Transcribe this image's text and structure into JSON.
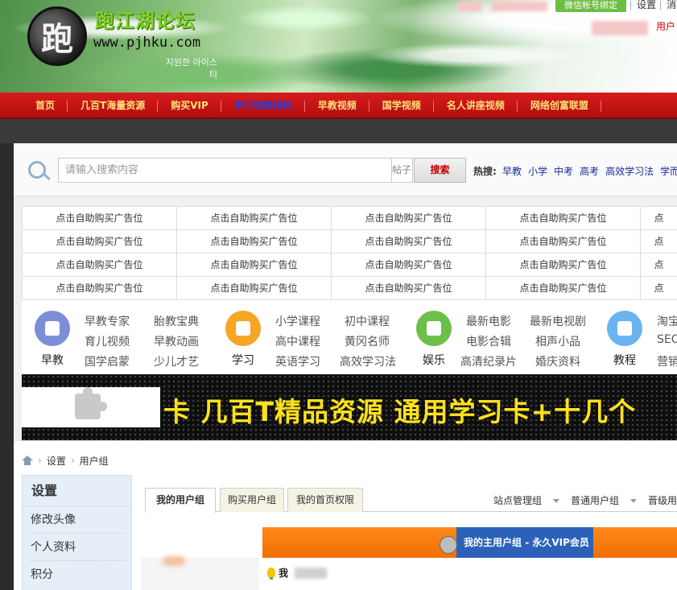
{
  "header": {
    "logo_char": "跑",
    "site_title": "跑江湖论坛",
    "site_url": "www.pjhku.com",
    "logo_sub": "지원한 아이스티",
    "wechat_label": "微信帐号绑定",
    "settings_link": "设置",
    "clear_link": "消",
    "user_link": "用户"
  },
  "nav": {
    "items": [
      {
        "label": "首页"
      },
      {
        "label": "几百T海量资源"
      },
      {
        "label": "购买VIP"
      },
      {
        "label": "学习视频资料"
      },
      {
        "label": "早教视频"
      },
      {
        "label": "国学视频"
      },
      {
        "label": "名人讲座视频"
      },
      {
        "label": "网络创富联盟"
      }
    ]
  },
  "search": {
    "placeholder": "请输入搜索内容",
    "type_label": "帖子",
    "button_label": "搜索",
    "hot_label": "热搜:",
    "hot_links": [
      "早教",
      "小学",
      "中考",
      "高考",
      "高效学习法",
      "学而"
    ]
  },
  "ads": {
    "rows": [
      [
        "点击自助购买广告位",
        "点击自助购买广告位",
        "点击自助购买广告位",
        "点击自助购买广告位",
        "点"
      ],
      [
        "点击自助购买广告位",
        "点击自助购买广告位",
        "点击自助购买广告位",
        "点击自助购买广告位",
        "点"
      ],
      [
        "点击自助购买广告位",
        "点击自助购买广告位",
        "点击自助购买广告位",
        "点击自助购买广告位",
        "点"
      ],
      [
        "点击自助购买广告位",
        "点击自助购买广告位",
        "点击自助购买广告位",
        "点击自助购买广告位",
        "点"
      ]
    ]
  },
  "categories": [
    {
      "title": "早教",
      "color": "#7c8fd6",
      "links": [
        "早教专家",
        "胎教宝典",
        "育儿视频",
        "早教动画",
        "国学启蒙",
        "少儿才艺"
      ]
    },
    {
      "title": "学习",
      "color": "#f5a623",
      "links": [
        "小学课程",
        "初中课程",
        "高中课程",
        "黄冈名师",
        "英语学习",
        "高效学习法"
      ]
    },
    {
      "title": "娱乐",
      "color": "#6cc04a",
      "links": [
        "最新电影",
        "最新电视剧",
        "电影合辑",
        "相声小品",
        "高清纪录片",
        "婚庆资料"
      ]
    },
    {
      "title": "教程",
      "color": "#6ab4f0",
      "links": [
        "淘宝",
        "SEO",
        "营销"
      ]
    }
  ],
  "banner": {
    "text": "卡 几百T精品资源 通用学习卡+十几个"
  },
  "breadcrumb": {
    "items": [
      "设置",
      "用户组"
    ]
  },
  "sidebar": {
    "title": "设置",
    "items": [
      "修改头像",
      "个人资料",
      "积分"
    ]
  },
  "tabs": {
    "items": [
      "我的用户组",
      "购买用户组",
      "我的首页权限"
    ],
    "right_items": [
      "站点管理组",
      "普通用户组",
      "晋级用户"
    ]
  },
  "group": {
    "label": "我的主用户组 - 永久VIP会员",
    "tip_text": "我"
  }
}
